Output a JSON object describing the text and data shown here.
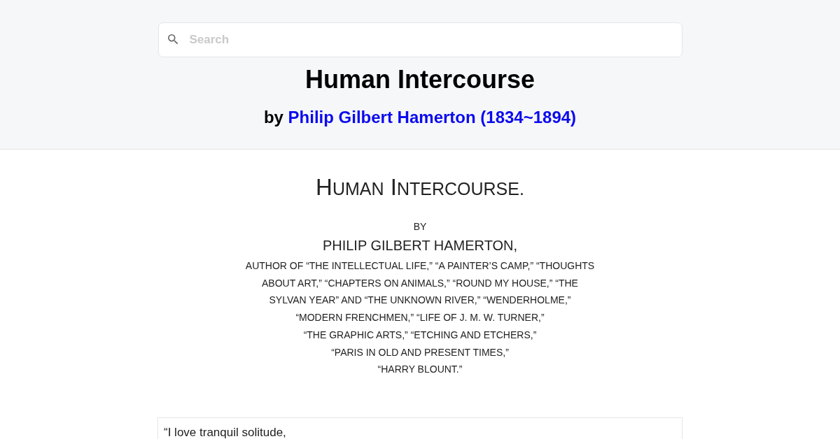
{
  "search": {
    "placeholder": "Search"
  },
  "header": {
    "title": "Human Intercourse",
    "byline": {
      "prefix": "by",
      "author_link": "Philip Gilbert Hamerton (1834~1894)"
    }
  },
  "title_page": {
    "title": "HUMAN INTERCOURSE.",
    "by": "BY",
    "author": "PHILIP GILBERT HAMERTON,",
    "works_lines": [
      "AUTHOR OF “THE INTELLECTUAL LIFE,” “A PAINTER’S CAMP,” “THOUGHTS",
      "ABOUT ART,” “CHAPTERS ON ANIMALS,” “ROUND MY HOUSE,” “THE",
      "SYLVAN YEAR” AND “THE UNKNOWN RIVER,” “WENDERHOLME,”",
      "“MODERN FRENCHMEN,” “LIFE OF J. M. W. TURNER,”",
      "“THE GRAPHIC ARTS,” “ETCHING AND ETCHERS,”",
      "“PARIS IN OLD AND PRESENT TIMES,”",
      "“HARRY BLOUNT.”"
    ]
  },
  "epigraph": {
    "lines": [
      "“I love tranquil solitude,"
    ]
  }
}
